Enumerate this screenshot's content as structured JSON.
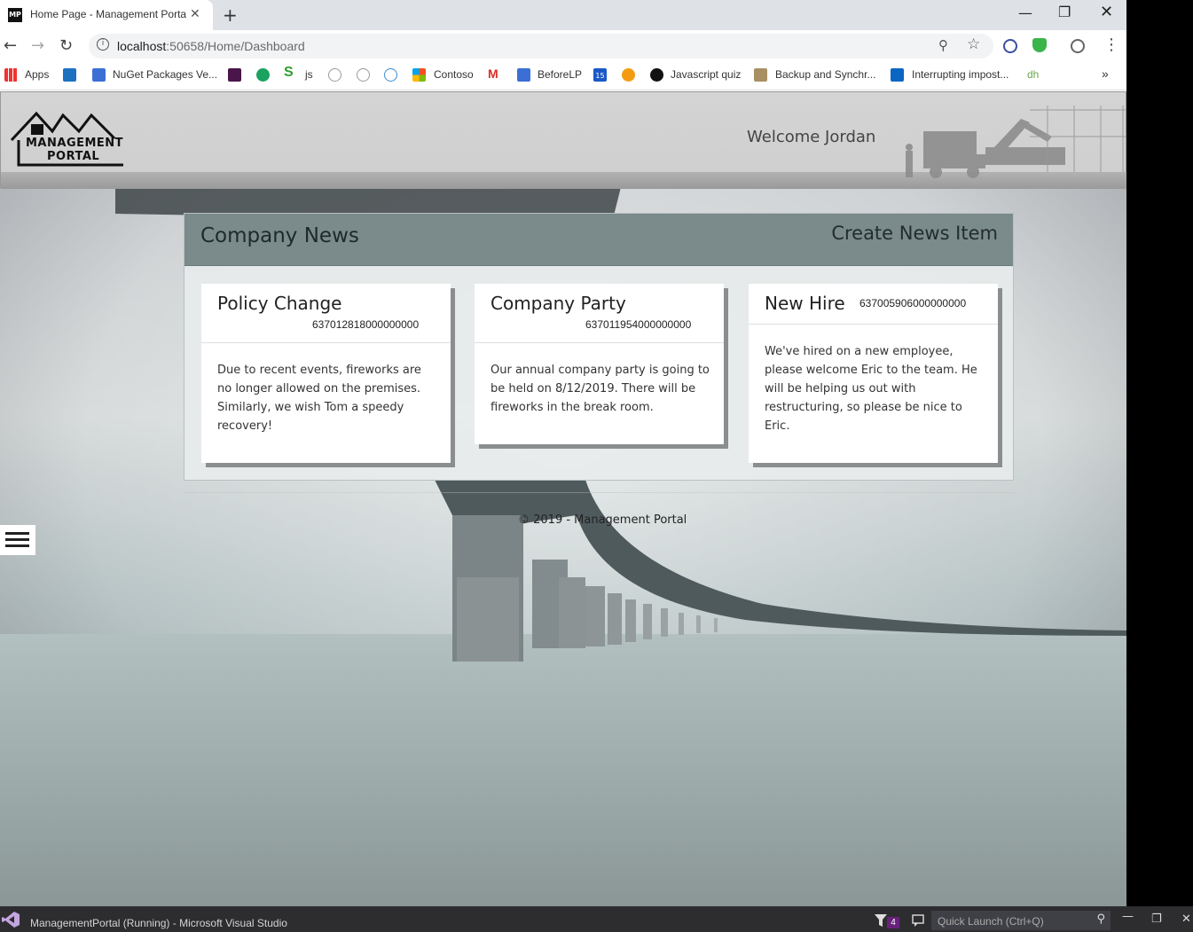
{
  "browser": {
    "tab_title": "Home Page - Management Porta",
    "tab_favicon_text": "MP",
    "new_tab": "+",
    "url_host": "localhost",
    "url_path": ":50658/Home/Dashboard",
    "bookmarks": [
      "Apps",
      "NuGet Packages Ve...",
      "js",
      "Contoso",
      "BeforeLP",
      "Javascript quiz",
      "Backup and Synchr...",
      "Interrupting impost...",
      "dh"
    ],
    "calendar_badge": "15",
    "more_bookmarks": "»"
  },
  "header": {
    "logo_line1": "MANAGEMENT",
    "logo_line2": "PORTAL",
    "welcome": "Welcome Jordan"
  },
  "news": {
    "title": "Company News",
    "create_label": "Create News Item",
    "cards": [
      {
        "title": "Policy Change",
        "id": "637012818000000000",
        "body": "Due to recent events, fireworks are no longer allowed on the premises. Similarly, we wish Tom a speedy recovery!"
      },
      {
        "title": "Company Party",
        "id": "637011954000000000",
        "body": "Our annual company party is going to be held on 8/12/2019. There will be fireworks in the break room."
      },
      {
        "title": "New Hire",
        "id": "637005906000000000",
        "body": "We've hired on a new employee, please welcome Eric to the team. He will be helping us out with restructuring, so please be nice to Eric."
      }
    ]
  },
  "footer": {
    "text": "© 2019 - Management Portal"
  },
  "taskbar": {
    "title": "ManagementPortal (Running) - Microsoft Visual Studio",
    "filter_count": "4",
    "quick_launch_placeholder": "Quick Launch (Ctrl+Q)"
  },
  "colors": {
    "news_header": "#7b8a8b",
    "tab_strip": "#dee1e6",
    "taskbar": "#2d2d30",
    "vs_purple": "#68217a"
  }
}
